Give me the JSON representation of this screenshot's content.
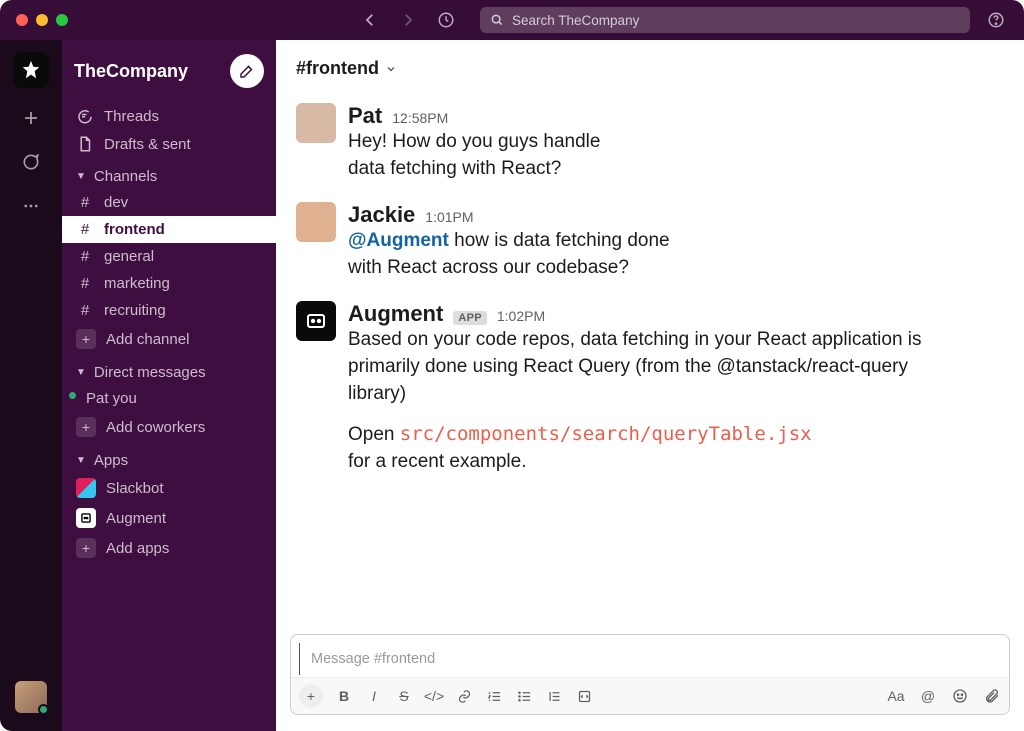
{
  "workspace": {
    "name": "TheCompany"
  },
  "search": {
    "placeholder": "Search TheCompany"
  },
  "sidebar": {
    "threads": "Threads",
    "drafts": "Drafts & sent",
    "channels_label": "Channels",
    "channels": [
      {
        "name": "dev"
      },
      {
        "name": "frontend"
      },
      {
        "name": "general"
      },
      {
        "name": "marketing"
      },
      {
        "name": "recruiting"
      }
    ],
    "add_channel": "Add channel",
    "dms_label": "Direct messages",
    "dms": [
      {
        "name": "Pat you"
      }
    ],
    "add_coworkers": "Add coworkers",
    "apps_label": "Apps",
    "apps": [
      {
        "name": "Slackbot"
      },
      {
        "name": "Augment"
      }
    ],
    "add_apps": "Add apps"
  },
  "channel": {
    "name": "#frontend",
    "composer_placeholder": "Message #frontend"
  },
  "messages": [
    {
      "author": "Pat",
      "time": "12:58PM",
      "lines": [
        "Hey! How do you guys handle",
        "data fetching with React?"
      ]
    },
    {
      "author": "Jackie",
      "time": "1:01PM",
      "mention": "@Augment",
      "lines_after_mention": [
        "how is data fetching done",
        "with React across our codebase?"
      ]
    },
    {
      "author": "Augment",
      "app": "APP",
      "time": "1:02PM",
      "body": "Based on your code repos, data fetching in your React application is primarily done using React Query (from the @tanstack/react-query library)",
      "open_prefix": "Open ",
      "code_path": "src/components/search/queryTable.jsx",
      "open_suffix": " for a recent example."
    }
  ]
}
